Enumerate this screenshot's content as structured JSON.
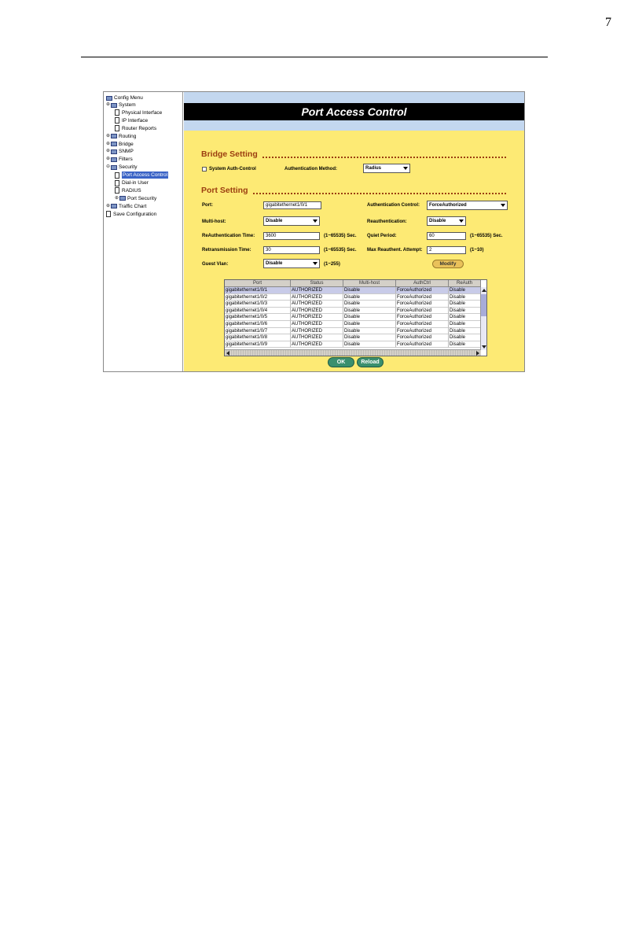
{
  "page": {
    "number": "7"
  },
  "sidebar": {
    "root": "Config Menu",
    "items": [
      {
        "label": "System",
        "type": "folder",
        "expander": "+"
      },
      {
        "label": "Physical Interface",
        "type": "doc"
      },
      {
        "label": "IP Interface",
        "type": "doc"
      },
      {
        "label": "Router Reports",
        "type": "doc"
      },
      {
        "label": "Routing",
        "type": "folder",
        "expander": "+"
      },
      {
        "label": "Bridge",
        "type": "folder",
        "expander": "+"
      },
      {
        "label": "SNMP",
        "type": "folder",
        "expander": "+"
      },
      {
        "label": "Filters",
        "type": "folder",
        "expander": "+"
      },
      {
        "label": "Security",
        "type": "folder",
        "expander": "-"
      },
      {
        "label": "Port Access Control",
        "type": "doc",
        "selected": true
      },
      {
        "label": "Dial-in User",
        "type": "doc"
      },
      {
        "label": "RADIUS",
        "type": "doc"
      },
      {
        "label": "Port Security",
        "type": "folder",
        "expander": "+"
      },
      {
        "label": "Traffic Chart",
        "type": "folder",
        "expander": "+"
      },
      {
        "label": "Save Configuration",
        "type": "doc"
      }
    ]
  },
  "title": "Port Access Control",
  "bridge_setting": {
    "heading": "Bridge Setting",
    "system_auth_label": "System Auth-Control",
    "system_auth_checked": false,
    "auth_method_label": "Authentication Method:",
    "auth_method_value": "Radius"
  },
  "port_setting": {
    "heading": "Port Setting",
    "port_label": "Port:",
    "port_value": "gigabitethernet1/0/1",
    "auth_control_label": "Authentication Control:",
    "auth_control_value": "ForceAuthorized",
    "multi_host_label": "Multi-host:",
    "multi_host_value": "Disable",
    "reauth_label": "Reauthentication:",
    "reauth_value": "Disable",
    "reauth_time_label": "ReAuthentication Time:",
    "reauth_time_value": "3600",
    "reauth_time_hint": "(1~65535) Sec.",
    "quiet_period_label": "Quiet Period:",
    "quiet_period_value": "60",
    "quiet_period_hint": "(1~65535) Sec.",
    "retrans_label": "Retransmission Time:",
    "retrans_value": "30",
    "retrans_hint": "(1~65535) Sec.",
    "max_reauth_label": "Max Reauthent. Attempt:",
    "max_reauth_value": "2",
    "max_reauth_hint": "(1~10)",
    "guest_vlan_label": "Guest Vlan:",
    "guest_vlan_value": "Disable",
    "guest_vlan_hint": "(1~255)",
    "modify_label": "Modify"
  },
  "table": {
    "columns": [
      "Port",
      "Status",
      "Multi-host",
      "AuthCtrl",
      "ReAuth"
    ],
    "rows": [
      [
        "gigabitethernet1/0/1",
        "AUTHORIZED",
        "Disable",
        "ForceAuthorized",
        "Disable"
      ],
      [
        "gigabitethernet1/0/2",
        "AUTHORIZED",
        "Disable",
        "ForceAuthorized",
        "Disable"
      ],
      [
        "gigabitethernet1/0/3",
        "AUTHORIZED",
        "Disable",
        "ForceAuthorized",
        "Disable"
      ],
      [
        "gigabitethernet1/0/4",
        "AUTHORIZED",
        "Disable",
        "ForceAuthorized",
        "Disable"
      ],
      [
        "gigabitethernet1/0/5",
        "AUTHORIZED",
        "Disable",
        "ForceAuthorized",
        "Disable"
      ],
      [
        "gigabitethernet1/0/6",
        "AUTHORIZED",
        "Disable",
        "ForceAuthorized",
        "Disable"
      ],
      [
        "gigabitethernet1/0/7",
        "AUTHORIZED",
        "Disable",
        "ForceAuthorized",
        "Disable"
      ],
      [
        "gigabitethernet1/0/8",
        "AUTHORIZED",
        "Disable",
        "ForceAuthorized",
        "Disable"
      ],
      [
        "gigabitethernet1/0/9",
        "AUTHORIZED",
        "Disable",
        "ForceAuthorized",
        "Disable"
      ]
    ],
    "selected_row": 0
  },
  "buttons": {
    "ok_label": "OK",
    "reload_label": "Reload"
  },
  "colors": {
    "panel_bg": "#fdea74",
    "title_bg": "#000000",
    "strip_bg": "#c3d7ef",
    "heading_color": "#9b3e10",
    "button_green": "#3a8f6e"
  }
}
